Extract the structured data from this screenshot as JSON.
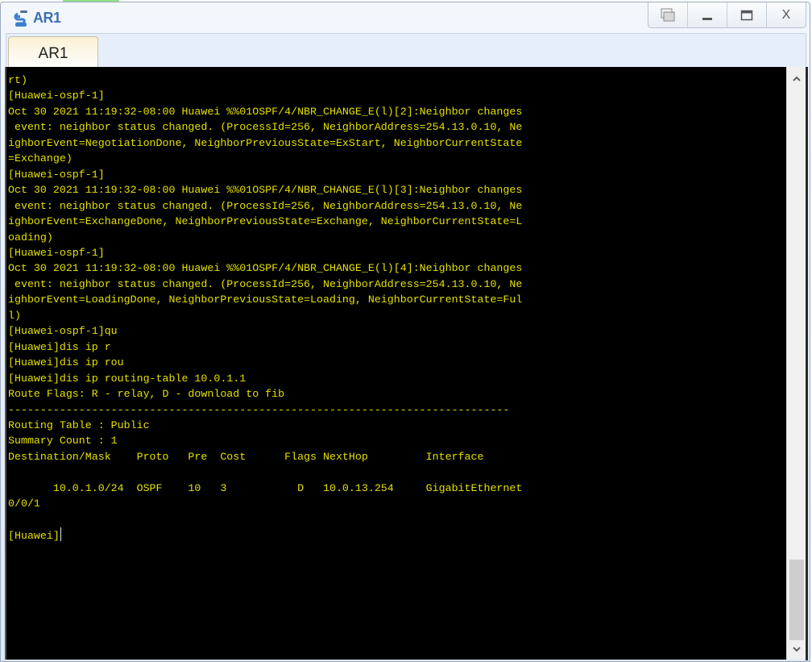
{
  "window": {
    "title": "AR1",
    "app_icon": "network-device-icon",
    "controls": [
      {
        "name": "restore-icon",
        "glyph": "❐"
      },
      {
        "name": "minimize-icon",
        "glyph": "_"
      },
      {
        "name": "maximize-icon",
        "glyph": "□"
      },
      {
        "name": "close-icon",
        "glyph": "X"
      }
    ]
  },
  "tabs": [
    {
      "label": "AR1",
      "active": true
    }
  ],
  "terminal": {
    "colors": {
      "background": "#000000",
      "text": "#e3e000"
    },
    "lines": [
      "rt)",
      "[Huawei-ospf-1]",
      "Oct 30 2021 11:19:32-08:00 Huawei %%01OSPF/4/NBR_CHANGE_E(l)[2]:Neighbor changes",
      " event: neighbor status changed. (ProcessId=256, NeighborAddress=254.13.0.10, Ne",
      "ighborEvent=NegotiationDone, NeighborPreviousState=ExStart, NeighborCurrentState",
      "=Exchange)",
      "[Huawei-ospf-1]",
      "Oct 30 2021 11:19:32-08:00 Huawei %%01OSPF/4/NBR_CHANGE_E(l)[3]:Neighbor changes",
      " event: neighbor status changed. (ProcessId=256, NeighborAddress=254.13.0.10, Ne",
      "ighborEvent=ExchangeDone, NeighborPreviousState=Exchange, NeighborCurrentState=L",
      "oading)",
      "[Huawei-ospf-1]",
      "Oct 30 2021 11:19:32-08:00 Huawei %%01OSPF/4/NBR_CHANGE_E(l)[4]:Neighbor changes",
      " event: neighbor status changed. (ProcessId=256, NeighborAddress=254.13.0.10, Ne",
      "ighborEvent=LoadingDone, NeighborPreviousState=Loading, NeighborCurrentState=Ful",
      "l)",
      "[Huawei-ospf-1]qu",
      "[Huawei]dis ip r",
      "[Huawei]dis ip rou",
      "[Huawei]dis ip routing-table 10.0.1.1",
      "Route Flags: R - relay, D - download to fib",
      "------------------------------------------------------------------------------",
      "Routing Table : Public",
      "Summary Count : 1",
      "Destination/Mask    Proto   Pre  Cost      Flags NextHop         Interface",
      "",
      "       10.0.1.0/24  OSPF    10   3           D   10.0.13.254     GigabitEthernet",
      "0/0/1",
      "",
      "[Huawei]"
    ],
    "prompt": "[Huawei]",
    "routing_table": {
      "name": "Public",
      "summary_count": 1,
      "columns": [
        "Destination/Mask",
        "Proto",
        "Pre",
        "Cost",
        "Flags",
        "NextHop",
        "Interface"
      ],
      "rows": [
        [
          "10.0.1.0/24",
          "OSPF",
          "10",
          "3",
          "D",
          "10.0.13.254",
          "GigabitEthernet0/0/1"
        ]
      ]
    }
  },
  "scrollbar": {
    "up_glyph": "^",
    "down_glyph": "v",
    "position_fraction": 1.0
  }
}
